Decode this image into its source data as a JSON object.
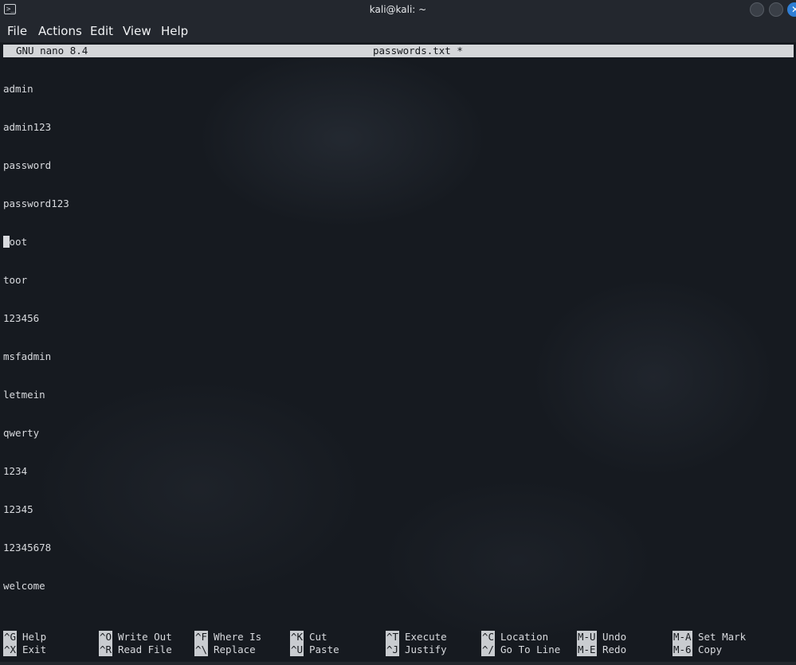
{
  "window": {
    "title": "kali@kali: ~",
    "icon": "terminal-icon",
    "close_symbol": "✕"
  },
  "menu": [
    "File",
    "Actions",
    "Edit",
    "View",
    "Help"
  ],
  "nano": {
    "version": "GNU nano 8.4",
    "filename": "passwords.txt *"
  },
  "file_lines": [
    "admin",
    "admin123",
    "password",
    "password123",
    "root",
    "toor",
    "123456",
    "msfadmin",
    "letmein",
    "qwerty",
    "1234",
    "12345",
    "12345678",
    "welcome"
  ],
  "shortcuts": {
    "row1": [
      {
        "key": "^G",
        "label": "Help"
      },
      {
        "key": "^O",
        "label": "Write Out"
      },
      {
        "key": "^F",
        "label": "Where Is"
      },
      {
        "key": "^K",
        "label": "Cut"
      },
      {
        "key": "^T",
        "label": "Execute"
      },
      {
        "key": "^C",
        "label": "Location"
      },
      {
        "key": "M-U",
        "label": "Undo"
      },
      {
        "key": "M-A",
        "label": "Set Mark"
      }
    ],
    "row2": [
      {
        "key": "^X",
        "label": "Exit"
      },
      {
        "key": "^R",
        "label": "Read File"
      },
      {
        "key": "^\\",
        "label": "Replace"
      },
      {
        "key": "^U",
        "label": "Paste"
      },
      {
        "key": "^J",
        "label": "Justify"
      },
      {
        "key": "^/",
        "label": "Go To Line"
      },
      {
        "key": "M-E",
        "label": "Redo"
      },
      {
        "key": "M-6",
        "label": "Copy"
      }
    ]
  },
  "colors": {
    "header_bg": "#d4d6d9",
    "text": "#d8dade",
    "accent_close": "#2f7fd6"
  }
}
